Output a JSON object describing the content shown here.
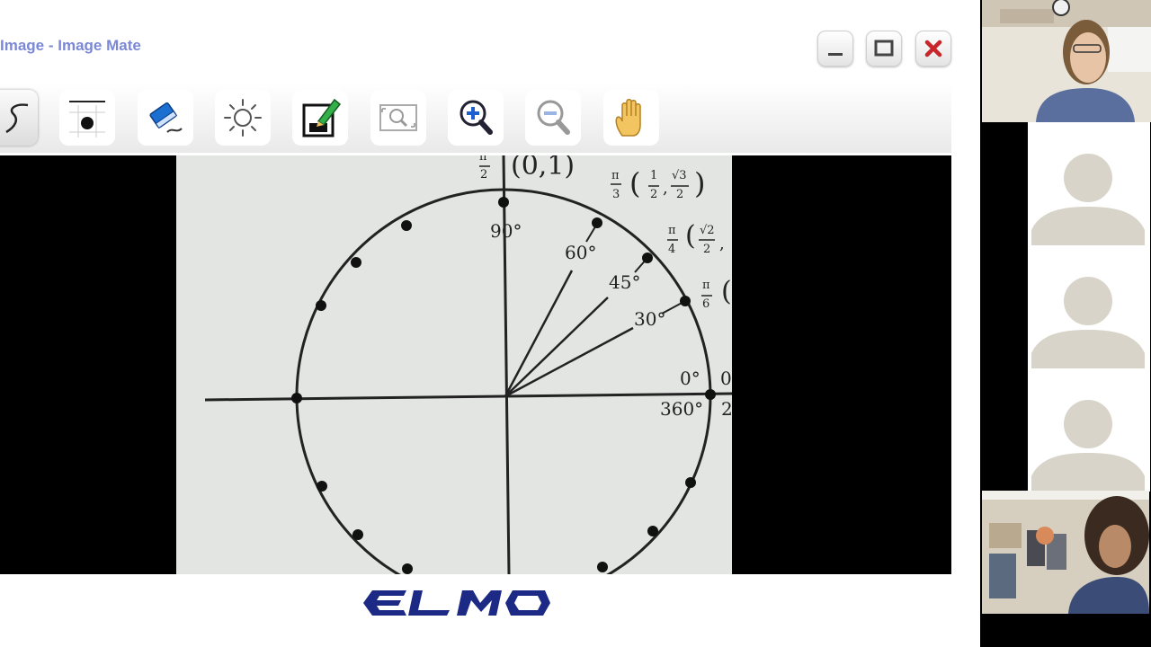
{
  "window": {
    "title": "Image - Image Mate",
    "minimize_icon": "minimize-icon",
    "maximize_icon": "maximize-icon",
    "close_icon": "close-icon",
    "close_color": "#c8262b"
  },
  "toolbar": {
    "tools": [
      {
        "name": "pen-tool",
        "icon": "pen-stroke-icon"
      },
      {
        "name": "line-width-tool",
        "icon": "line-width-icon"
      },
      {
        "name": "eraser-tool",
        "icon": "eraser-icon"
      },
      {
        "name": "brightness-tool",
        "icon": "sun-icon"
      },
      {
        "name": "save-edit-tool",
        "icon": "save-pencil-icon"
      },
      {
        "name": "fit-zoom-tool",
        "icon": "zoom-fit-icon"
      },
      {
        "name": "zoom-in-tool",
        "icon": "zoom-in-icon"
      },
      {
        "name": "zoom-out-tool",
        "icon": "zoom-out-icon"
      },
      {
        "name": "pan-tool",
        "icon": "hand-icon"
      }
    ]
  },
  "unit_circle": {
    "top_fraction": {
      "num": "π",
      "den": "2"
    },
    "top_point": "(0,1)",
    "pi3": {
      "num": "π",
      "den": "3",
      "x_num": "1",
      "x_den": "2",
      "y_num": "√3",
      "y_den": "2"
    },
    "pi4": {
      "num": "π",
      "den": "4",
      "x_num": "√2",
      "x_den": "2"
    },
    "pi6": {
      "num": "π",
      "den": "6"
    },
    "angles": {
      "a90": "90°",
      "a60": "60°",
      "a45": "45°",
      "a30": "30°",
      "a0": "0°",
      "a360": "360°"
    },
    "right_edge_top": "0",
    "right_edge_bottom": "2"
  },
  "footer": {
    "logo_text": "ELMO",
    "logo_color": "#1c2a86"
  },
  "participants": {
    "placeholder_icon": "user-silhouette-icon"
  }
}
